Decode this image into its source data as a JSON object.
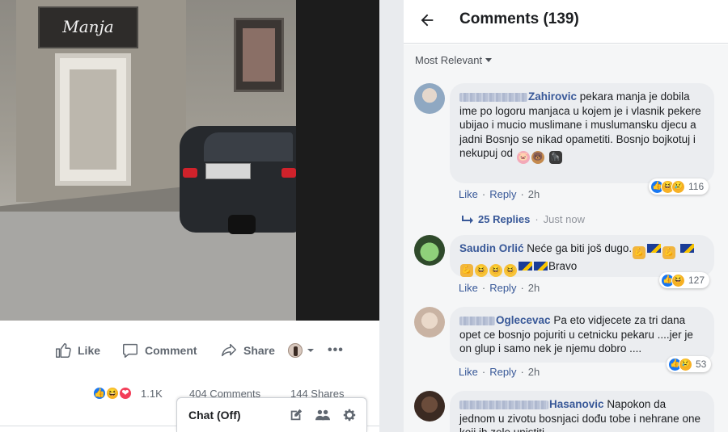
{
  "video": {
    "shop_sign": "Manja"
  },
  "post_actions": {
    "like_label": "Like",
    "comment_label": "Comment",
    "share_label": "Share",
    "more_label": "•••"
  },
  "post_stats": {
    "reaction_count": "1.1K",
    "comments": "404 Comments",
    "shares": "144 Shares"
  },
  "chat": {
    "label": "Chat (Off)"
  },
  "panel": {
    "title": "Comments (139)",
    "sort_label": "Most Relevant"
  },
  "comments": [
    {
      "author_visible": "Zahirovic",
      "text": "pekara manja je dobila ime po logoru manjaca u kojem je i vlasnik pekere ubijao i mucio muslimane i muslumansku djecu a jadni Bosnjo se nikad opametiti. Bosnjo bojkotuj i nekupuj od",
      "emoji": [
        "pig-face",
        "bear-face",
        "gorilla"
      ],
      "like": "Like",
      "reply": "Reply",
      "time": "2h",
      "reactions": "116",
      "replies": {
        "label": "25 Replies",
        "time": "Just now"
      }
    },
    {
      "author": "Saudin Orlić",
      "text_before": "Neće ga biti još dugo.",
      "text_after": "Bravo",
      "emoji": [
        "flexed-biceps",
        "flag-bosnia",
        "flexed-biceps",
        "flag-bosnia",
        "flexed-biceps",
        "laughing",
        "laughing",
        "laughing",
        "flag-bosnia",
        "flag-bosnia"
      ],
      "like": "Like",
      "reply": "Reply",
      "time": "2h",
      "reactions": "127"
    },
    {
      "author_visible": "Oglecevac",
      "text": "Pa eto vidjecete za tri dana opet ce bosnjo pojuriti u cetnicku pekaru ....jer je on glup i samo nek je njemu dobro ....",
      "like": "Like",
      "reply": "Reply",
      "time": "2h",
      "reactions": "53"
    },
    {
      "author_visible": "Hasanovic",
      "text": "Napokon da jednom u zivotu bosnjaci dođu tobe i nehrane one koji ih zele unistiti"
    }
  ],
  "colors": {
    "link_blue": "#385898",
    "bubble_gray": "#ebedf0",
    "panel_bg": "#f5f6f7",
    "like_blue": "#1877f2"
  }
}
